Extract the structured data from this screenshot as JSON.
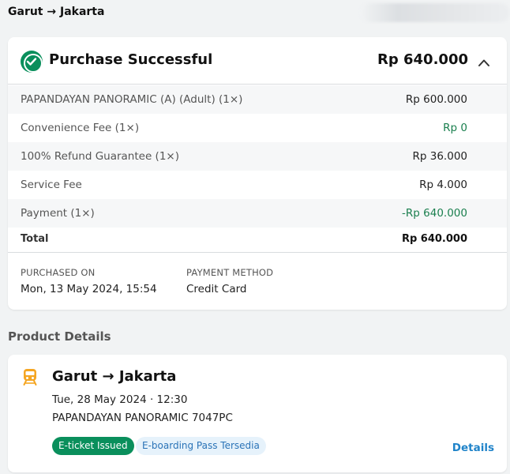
{
  "header": {
    "route": "Garut → Jakarta"
  },
  "purchase": {
    "status_title": "Purchase Successful",
    "total_amount": "Rp 640.000",
    "line_items": [
      {
        "label": "PAPANDAYAN PANORAMIC (A) (Adult) (1×)",
        "value": "Rp 600.000"
      },
      {
        "label": "Convenience Fee (1×)",
        "value": "Rp 0"
      },
      {
        "label": "100% Refund Guarantee (1×)",
        "value": "Rp 36.000"
      },
      {
        "label": "Service Fee",
        "value": "Rp 4.000"
      },
      {
        "label": "Payment (1×)",
        "value": "-Rp 640.000"
      }
    ],
    "total_label": "Total",
    "total_value": "Rp 640.000",
    "purchased_on_label": "PURCHASED ON",
    "purchased_on_value": "Mon, 13 May 2024, 15:54",
    "payment_method_label": "PAYMENT METHOD",
    "payment_method_value": "Credit Card"
  },
  "product": {
    "section_title": "Product Details",
    "route": "Garut → Jakarta",
    "departure": "Tue, 28 May 2024 · 12:30",
    "train": "PAPANDAYAN PANORAMIC 7047PC",
    "badge_issued": "E-ticket Issued",
    "badge_boarding": "E-boarding Pass Tersedia",
    "details_link": "Details"
  },
  "colors": {
    "success_green": "#0a8f5c",
    "link_blue": "#1f83c9",
    "train_icon": "#f5a623"
  },
  "icons": {
    "status": "check-circle-icon",
    "collapse": "chevron-up-icon",
    "product": "train-icon"
  }
}
